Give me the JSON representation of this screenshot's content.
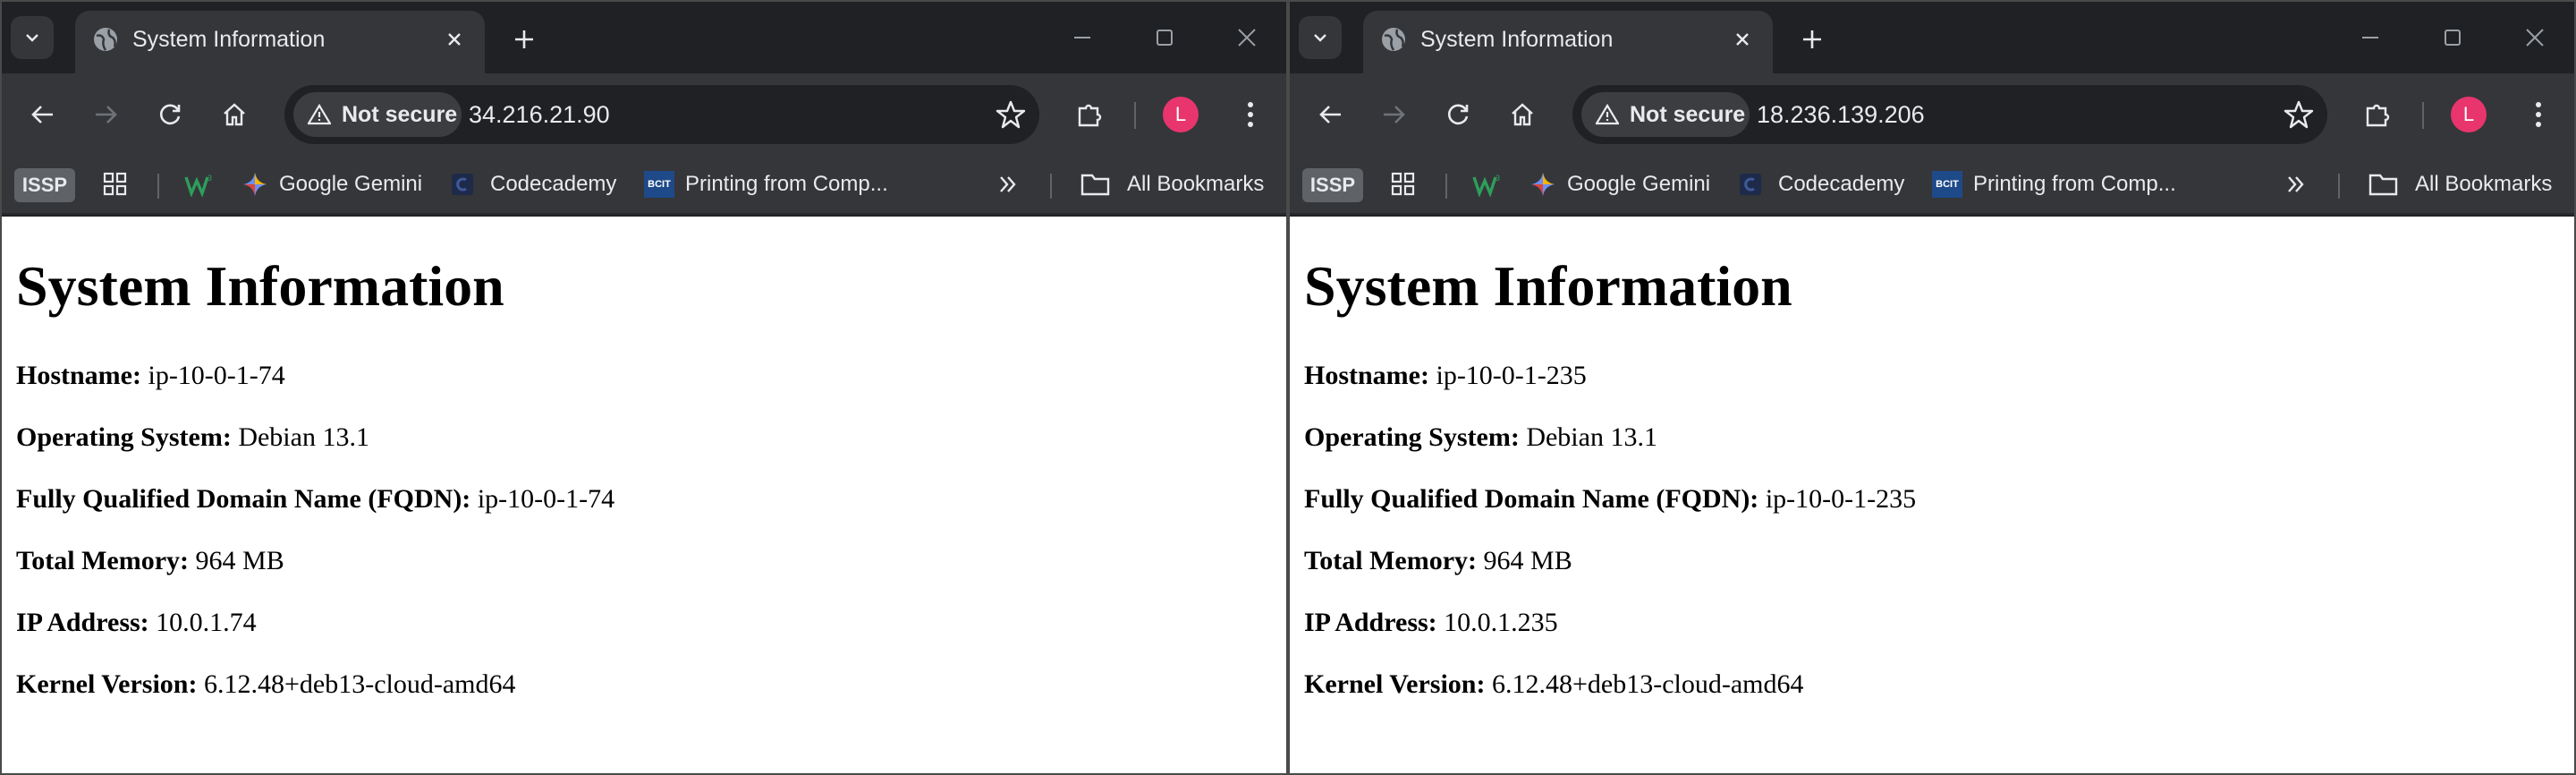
{
  "windows": [
    {
      "tab_title": "System Information",
      "security_chip": "Not secure",
      "url": "34.216.21.90",
      "avatar_letter": "L",
      "bookmarks": {
        "issp": "ISSP",
        "gemini": "Google Gemini",
        "codecademy": "Codecademy",
        "printing": "Printing from Comp...",
        "bcit_badge": "BCIT",
        "all_bookmarks": "All Bookmarks"
      },
      "page": {
        "heading": "System Information",
        "rows": [
          {
            "label": "Hostname:",
            "value": "ip-10-0-1-74"
          },
          {
            "label": "Operating System:",
            "value": "Debian 13.1"
          },
          {
            "label": "Fully Qualified Domain Name (FQDN):",
            "value": "ip-10-0-1-74"
          },
          {
            "label": "Total Memory:",
            "value": "964 MB"
          },
          {
            "label": "IP Address:",
            "value": "10.0.1.74"
          },
          {
            "label": "Kernel Version:",
            "value": "6.12.48+deb13-cloud-amd64"
          }
        ]
      }
    },
    {
      "tab_title": "System Information",
      "security_chip": "Not secure",
      "url": "18.236.139.206",
      "avatar_letter": "L",
      "bookmarks": {
        "issp": "ISSP",
        "gemini": "Google Gemini",
        "codecademy": "Codecademy",
        "printing": "Printing from Comp...",
        "bcit_badge": "BCIT",
        "all_bookmarks": "All Bookmarks"
      },
      "page": {
        "heading": "System Information",
        "rows": [
          {
            "label": "Hostname:",
            "value": "ip-10-0-1-235"
          },
          {
            "label": "Operating System:",
            "value": "Debian 13.1"
          },
          {
            "label": "Fully Qualified Domain Name (FQDN):",
            "value": "ip-10-0-1-235"
          },
          {
            "label": "Total Memory:",
            "value": "964 MB"
          },
          {
            "label": "IP Address:",
            "value": "10.0.1.235"
          },
          {
            "label": "Kernel Version:",
            "value": "6.12.48+deb13-cloud-amd64"
          }
        ]
      }
    }
  ],
  "colors": {
    "chrome_dark": "#202124",
    "toolbar": "#35363a",
    "avatar": "#e8356d",
    "page_bg": "#ffffff"
  }
}
